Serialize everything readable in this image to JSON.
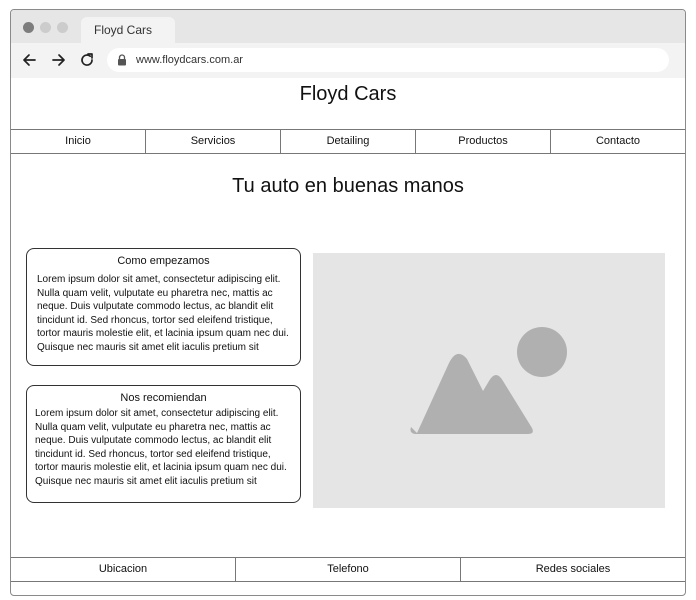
{
  "browser": {
    "tab_title": "Floyd Cars",
    "url": "www.floydcars.com.ar",
    "icons": [
      "back-arrow-icon",
      "forward-arrow-icon",
      "reload-icon",
      "lock-icon"
    ]
  },
  "site": {
    "title": "Floyd Cars"
  },
  "nav": {
    "items": [
      {
        "label": "Inicio"
      },
      {
        "label": "Servicios"
      },
      {
        "label": "Detailing"
      },
      {
        "label": "Productos"
      },
      {
        "label": "Contacto"
      }
    ]
  },
  "hero": {
    "title": "Tu auto en buenas manos"
  },
  "cards": [
    {
      "title": "Como empezamos",
      "body": "Lorem ipsum dolor sit amet, consectetur adipiscing elit. Nulla quam velit, vulputate eu pharetra nec, mattis ac neque. Duis vulputate commodo lectus, ac blandit elit tincidunt id. Sed rhoncus, tortor sed eleifend tristique, tortor mauris molestie elit, et lacinia ipsum quam nec dui. Quisque nec mauris sit amet elit iaculis pretium sit"
    },
    {
      "title": "Nos recomiendan",
      "body": "Lorem ipsum dolor sit amet, consectetur adipiscing elit. Nulla quam velit, vulputate eu pharetra nec, mattis ac neque. Duis vulputate commodo lectus, ac blandit elit tincidunt id. Sed rhoncus, tortor sed eleifend tristique, tortor mauris molestie elit, et lacinia ipsum quam nec dui. Quisque nec mauris sit amet elit iaculis pretium sit"
    }
  ],
  "image": {
    "icon": "image-placeholder-icon"
  },
  "footer": {
    "items": [
      {
        "label": "Ubicacion"
      },
      {
        "label": "Telefono"
      },
      {
        "label": "Redes sociales"
      }
    ]
  },
  "colors": {
    "window_dot_red": "#808080",
    "window_dot_yellow": "#c8c8c8",
    "window_dot_green": "#c8c8c8",
    "placeholder_bg": "#e5e5e5",
    "placeholder_shape": "#b0b0b0"
  }
}
